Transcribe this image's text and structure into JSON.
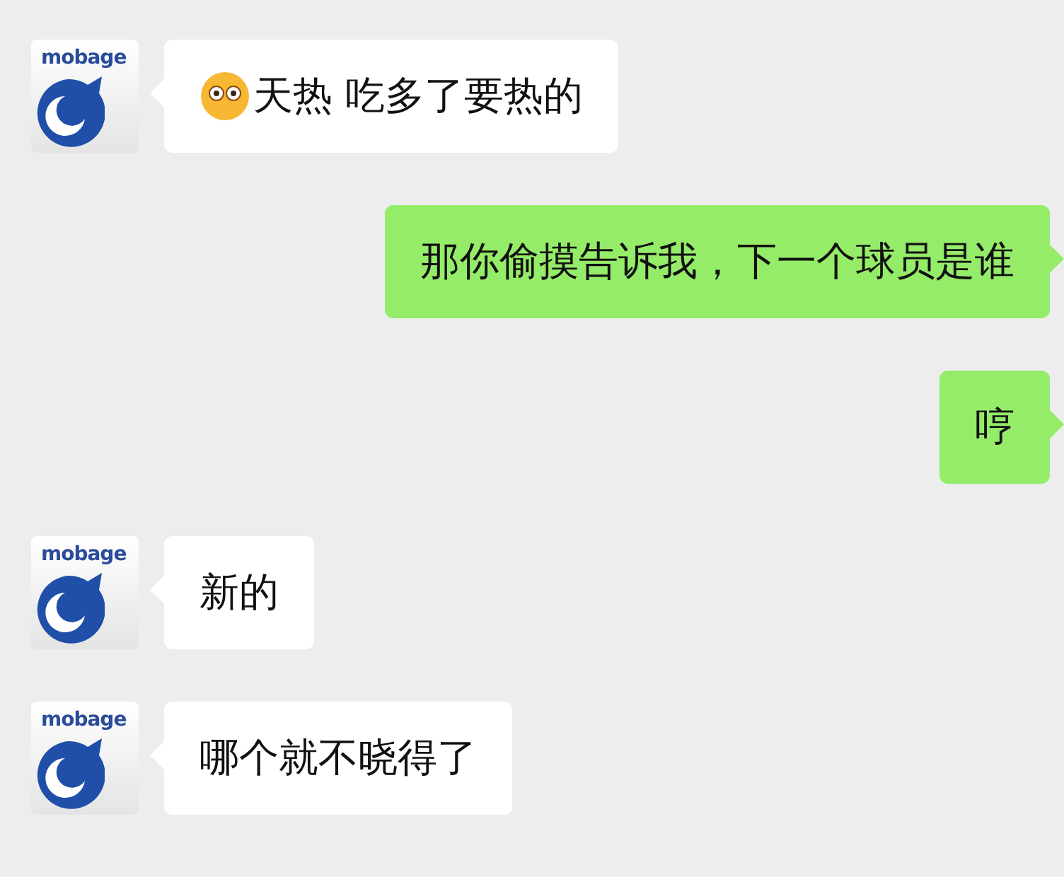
{
  "messages": [
    {
      "kind": "received",
      "avatar_text": "mobage",
      "has_emoji": true,
      "text": "天热 吃多了要热的"
    },
    {
      "kind": "sent",
      "has_emoji": false,
      "text": "那你偷摸告诉我，下一个球员是谁"
    },
    {
      "kind": "sent",
      "has_emoji": false,
      "text": "哼"
    },
    {
      "kind": "received",
      "avatar_text": "mobage",
      "has_emoji": false,
      "text": "新的"
    },
    {
      "kind": "received",
      "avatar_text": "mobage",
      "has_emoji": false,
      "text": "哪个就不晓得了"
    }
  ]
}
